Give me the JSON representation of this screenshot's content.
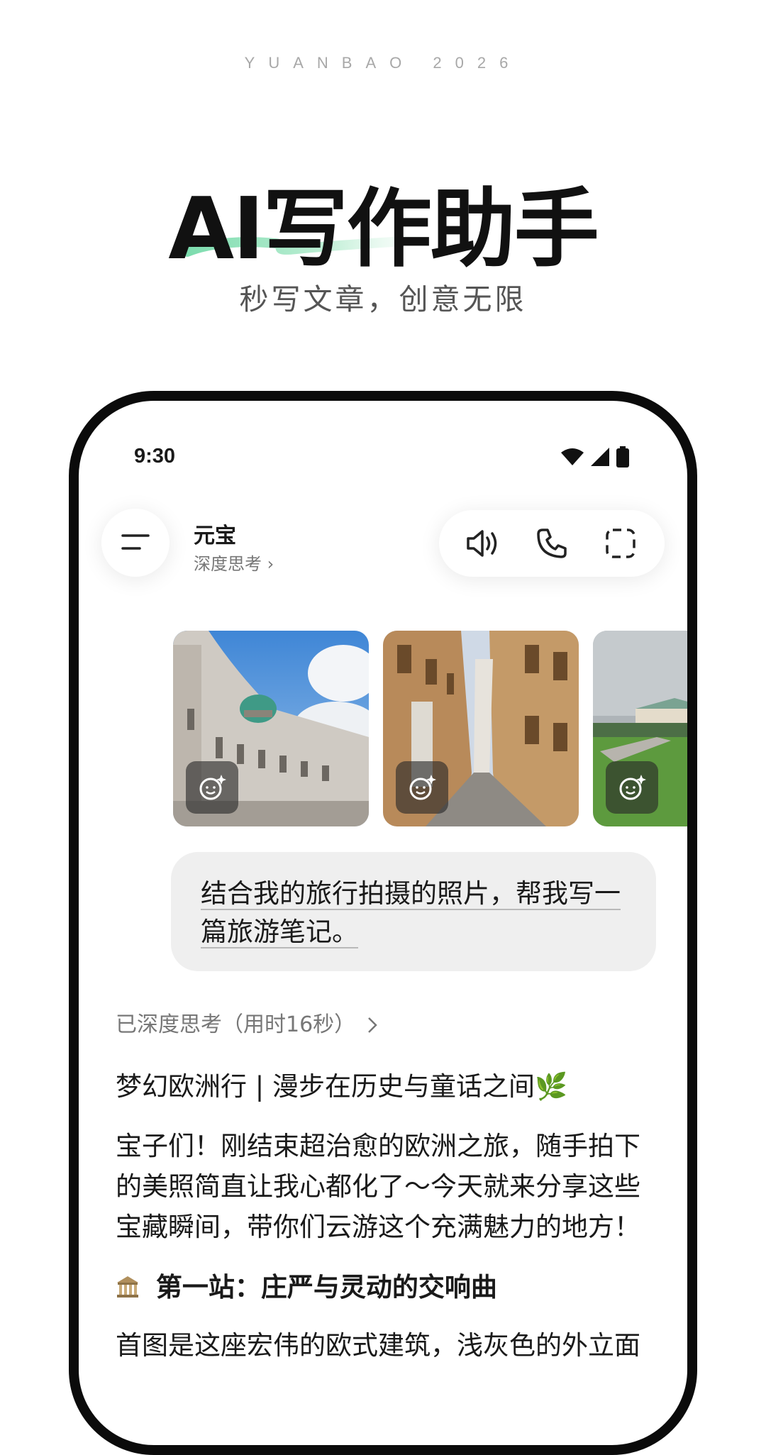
{
  "brand": "YUANBAO 2026",
  "headline": "AI写作助手",
  "subline": "秒写文章，创意无限",
  "colors": {
    "accent_green": "#7cdcae",
    "text_dark": "#111111",
    "bubble_bg": "#efefef"
  },
  "status_bar": {
    "time": "9:30",
    "icons": [
      "wifi-icon",
      "signal-icon",
      "battery-icon"
    ]
  },
  "chat_header": {
    "title": "元宝",
    "mode": "深度思考",
    "mode_chevron": "›",
    "actions": [
      "speaker-icon",
      "phone-icon",
      "screenshot-icon"
    ]
  },
  "photos": [
    {
      "subject": "ornate-palace-photo"
    },
    {
      "subject": "narrow-street-photo"
    },
    {
      "subject": "palace-garden-photo"
    }
  ],
  "user_message": {
    "line1": "结合我的旅行拍摄的照片，帮我写一",
    "line2": "篇旅游笔记。"
  },
  "thinking_status": "已深度思考（用时16秒）",
  "answer": {
    "title": "梦幻欧洲行 | 漫步在历史与童话之间🌿",
    "intro_lines": [
      "宝子们！刚结束超治愈的欧洲之旅，随手拍下",
      "的美照简直让我心都化了～今天就来分享这些",
      "宝藏瞬间，带你们云游这个充满魅力的地方！"
    ],
    "section_title": "第一站：庄严与灵动的交响曲",
    "section_icon": "classical-building-icon",
    "section_first_line": "首图是这座宏伟的欧式建筑，浅灰色的外立面"
  }
}
